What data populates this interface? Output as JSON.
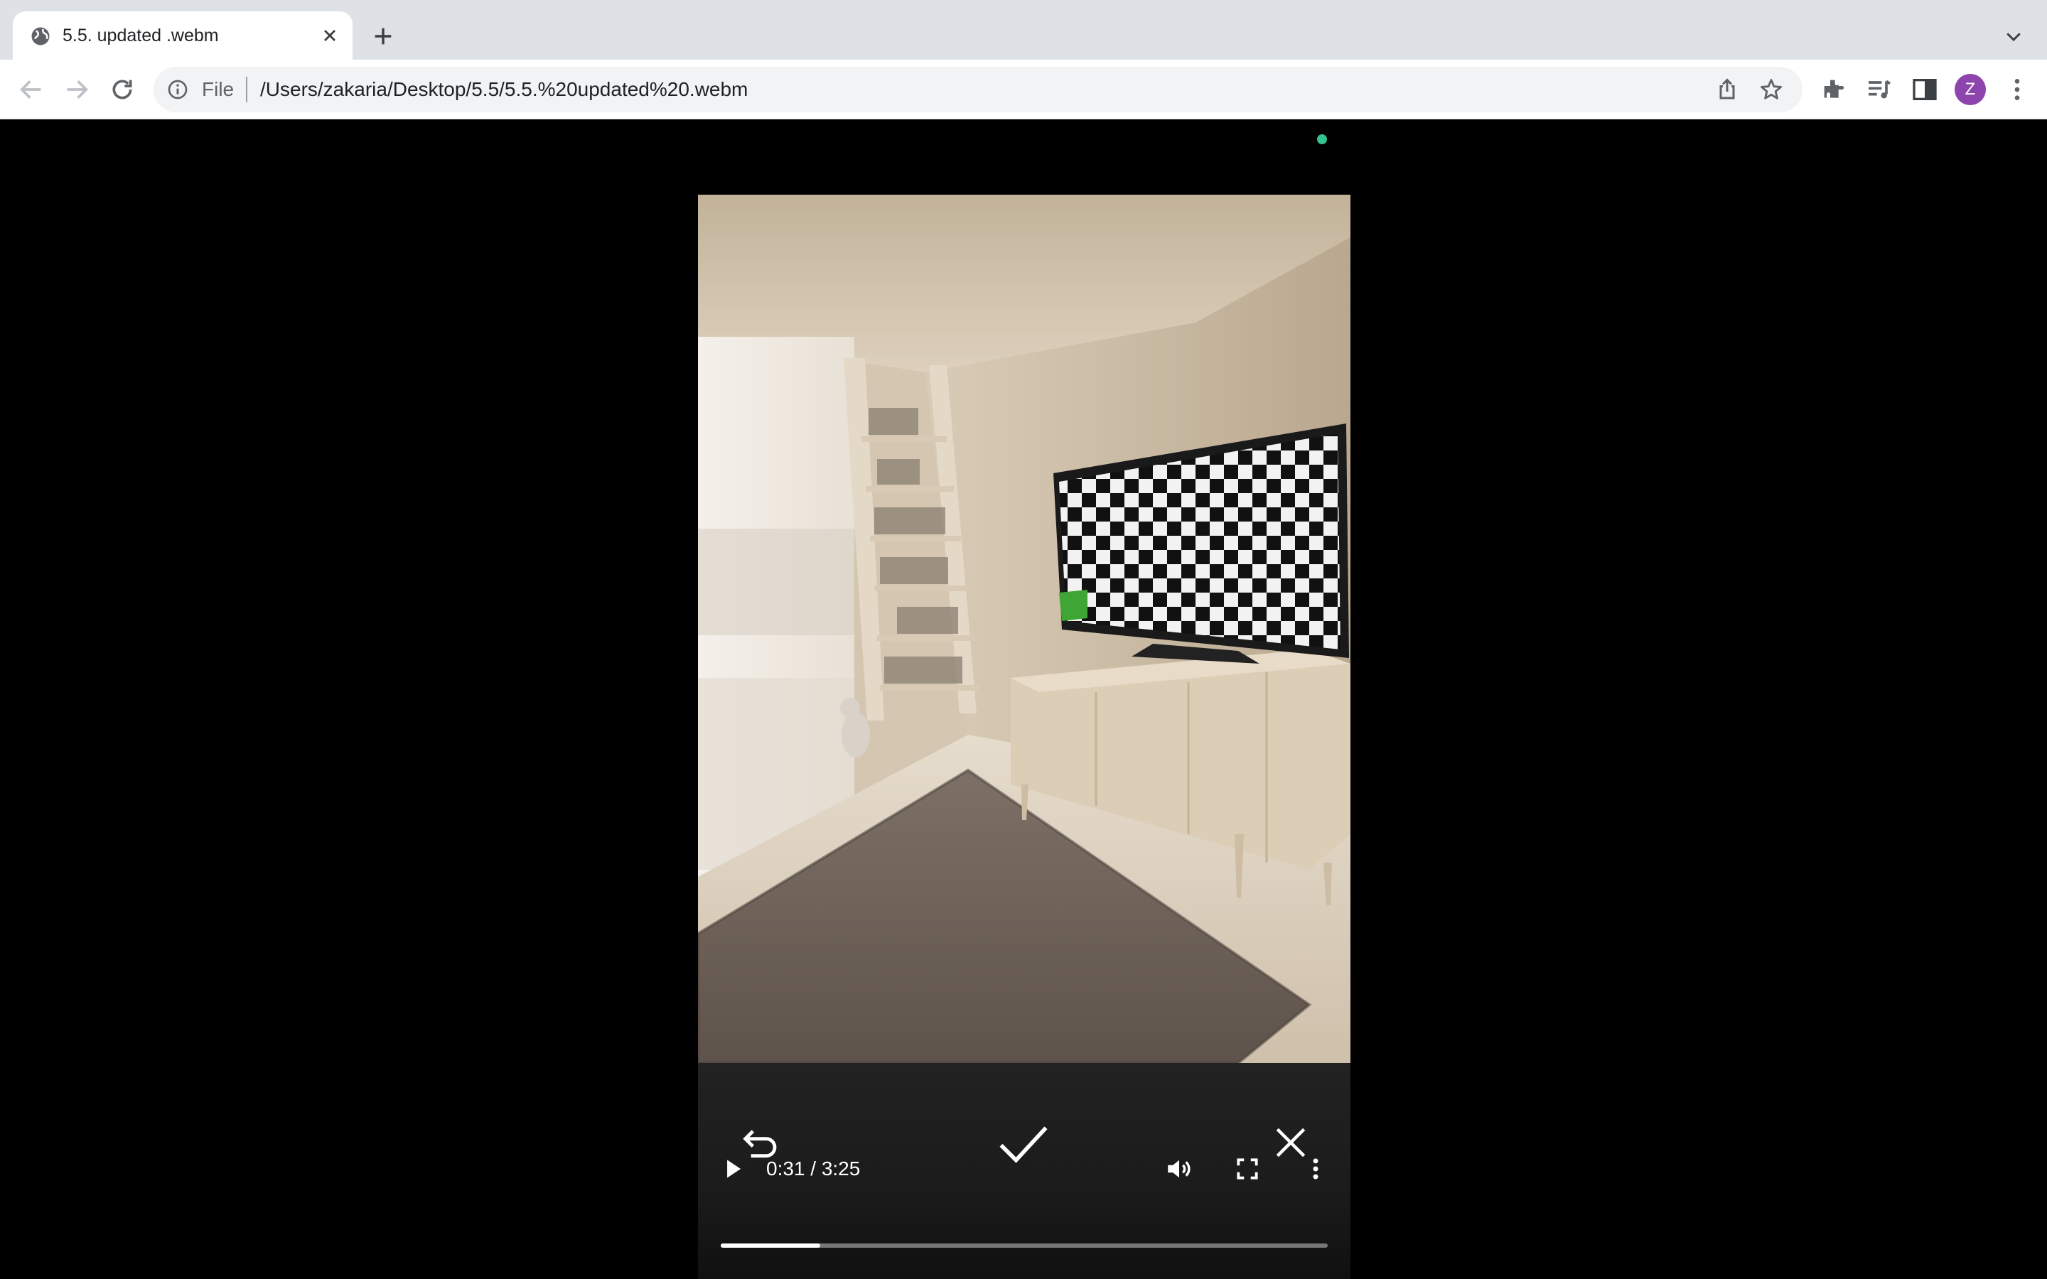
{
  "browser": {
    "tab": {
      "title": "5.5. updated .webm"
    },
    "address": {
      "scheme_label": "File",
      "url": "/Users/zakaria/Desktop/5.5/5.5.%20updated%20.webm"
    },
    "profile": {
      "initial": "Z",
      "color": "#8e44ad"
    }
  },
  "player": {
    "actions": {
      "undo_icon": "undo-icon",
      "confirm_icon": "checkmark-icon",
      "dismiss_icon": "close-icon"
    },
    "controls": {
      "time": "0:31 / 3:25",
      "progress": 0.164,
      "play_icon": "play-icon",
      "volume_icon": "volume-icon",
      "fullscreen_icon": "fullscreen-icon",
      "more_icon": "more-vert-icon"
    },
    "recording_indicator_color": "#34c38f",
    "scene_highlight_color": "#3fa535"
  }
}
